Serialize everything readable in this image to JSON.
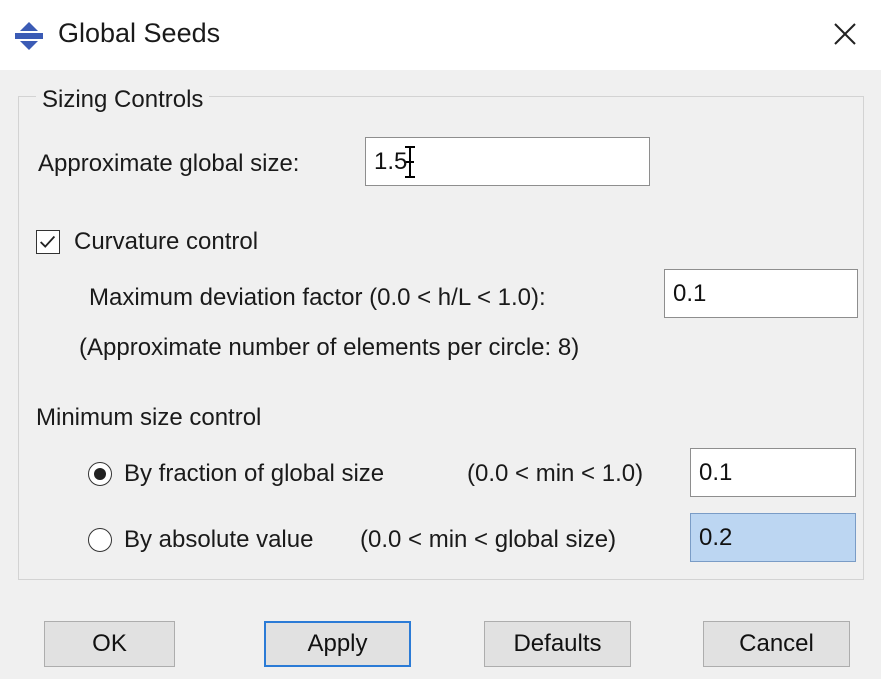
{
  "window": {
    "title": "Global Seeds",
    "icon": "abaqus-app-icon",
    "close_icon": "close-icon"
  },
  "sizing": {
    "group_label": "Sizing Controls",
    "global_size_label": "Approximate global size:",
    "global_size_value": "1.5",
    "curvature": {
      "checked": true,
      "label": "Curvature control",
      "deviation_label": "Maximum deviation factor (0.0 < h/L < 1.0):",
      "deviation_value": "0.1",
      "note": "(Approximate number of elements per circle: 8)"
    },
    "min_size": {
      "label": "Minimum size control",
      "selected": "fraction",
      "fraction_label": "By fraction of global size",
      "fraction_range": "(0.0 < min < 1.0)",
      "fraction_value": "0.1",
      "absolute_label": "By absolute value",
      "absolute_range": "(0.0 < min < global size)",
      "absolute_value": "0.2"
    }
  },
  "buttons": {
    "ok": "OK",
    "apply": "Apply",
    "defaults": "Defaults",
    "cancel": "Cancel"
  },
  "colors": {
    "dialog_bg": "#f0f0f0",
    "titlebar_bg": "#ffffff",
    "icon_blue": "#3b5bb5",
    "selection_bg": "#bcd6f2",
    "focus_border": "#2b7bd6"
  }
}
